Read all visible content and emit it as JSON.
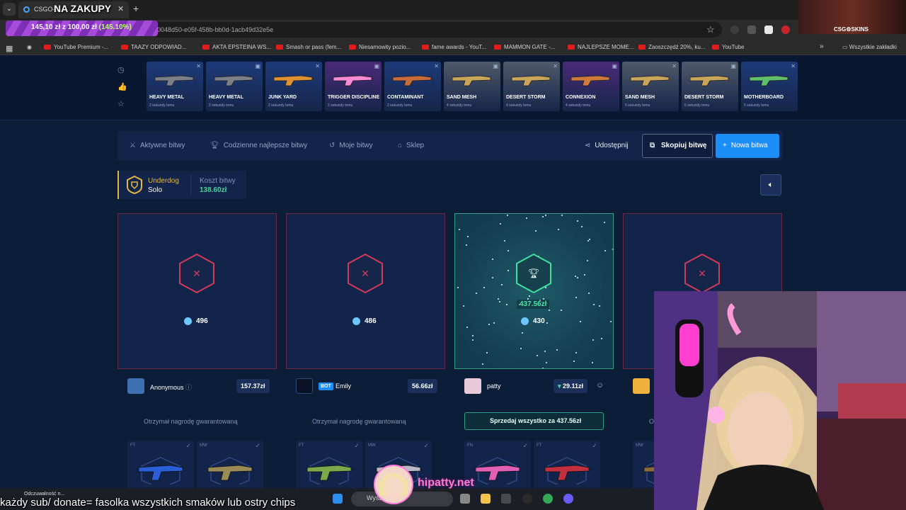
{
  "overlay": {
    "title": "NA ZAKUPY",
    "promo": {
      "current": "145,10 zł",
      "connector": "z",
      "target": "100,00 zł",
      "percent": "(145.10%)"
    },
    "chat_line": "każdy sub/ donate= fasolka wszystkich smaków lub ostry chips",
    "watermark": "hipatty.net",
    "cam_logo": "CSG⚙SKINS"
  },
  "browser": {
    "tab_title": "CSGO-S...",
    "url": "0048d50-e05f-458b-bb0d-1acb49d32e5e",
    "bookmarks": [
      "YouTube Premium -...",
      "TAAZY ODPOWIAD...",
      "AKTA EPSTEINA WS...",
      "Smash or pass (fem...",
      "Niesamowity pozio...",
      "fame awards - YouT...",
      "MAMMON GATE -...",
      "NAJLEPSZE MOME...",
      "Zaoszczędź 20%, ku...",
      "YouTube"
    ],
    "all_bookmarks": "Wszystkie zakładki"
  },
  "ticker": [
    {
      "name": "HEAVY METAL",
      "time": "2 sekundy temu",
      "color": "#1e3a7a"
    },
    {
      "name": "HEAVY METAL",
      "time": "2 sekundy temu",
      "color": "#1e3a7a"
    },
    {
      "name": "JUNK YARD",
      "time": "2 sekundy temu",
      "color": "#1e3a7a"
    },
    {
      "name": "TRIGGER DISCIPLINE",
      "time": "2 sekundy temu",
      "color": "#4a2a78"
    },
    {
      "name": "CONTAMINANT",
      "time": "2 sekundy temu",
      "color": "#1e3a7a"
    },
    {
      "name": "SAND MESH",
      "time": "4 sekundy temu",
      "color": "#4f5a6a"
    },
    {
      "name": "DESERT STORM",
      "time": "4 sekundy temu",
      "color": "#4f5a6a"
    },
    {
      "name": "CONNEXION",
      "time": "4 sekundy temu",
      "color": "#4a2a78"
    },
    {
      "name": "SAND MESH",
      "time": "5 sekundy temu",
      "color": "#4f5a6a"
    },
    {
      "name": "DESERT STORM",
      "time": "5 sekundy temu",
      "color": "#4f5a6a"
    },
    {
      "name": "MOTHERBOARD",
      "time": "5 sekundy temu",
      "color": "#1e3a7a"
    }
  ],
  "nav": {
    "active_battles": "Aktywne bitwy",
    "daily_best": "Codzienne najlepsze bitwy",
    "my_battles": "Moje bitwy",
    "shop": "Sklep",
    "share": "Udostępnij",
    "copy": "Skopiuj bitwę",
    "new": "Nowa bitwa"
  },
  "battle": {
    "mode": "Underdog",
    "type": "Solo",
    "cost_label": "Koszt bitwy",
    "cost": "138.60zł"
  },
  "players": [
    {
      "coins": "496",
      "name": "Anonymous",
      "value": "157.37zł",
      "status": "Otrzymał nagrodę gwarantowaną",
      "items": [
        "FT",
        "MW"
      ]
    },
    {
      "coins": "486",
      "name": "Emily",
      "bot": "BOT",
      "value": "56.66zł",
      "status": "Otrzymał nagrodę gwarantowaną",
      "items": [
        "FT",
        "MW"
      ]
    },
    {
      "coins": "430",
      "name": "patty",
      "value": "29.11zł",
      "winner_amount": "437.56zł",
      "sell": "Sprzedaj wszystko za 437.56zł",
      "items": [
        "FN",
        "FT"
      ]
    },
    {
      "name": "",
      "status": "O",
      "items": [
        "MW"
      ]
    }
  ],
  "taskbar": {
    "search": "Wyszu",
    "notif": "Odczuwalność n..."
  },
  "colors": {
    "accent": "#1c8ef7",
    "win": "#2aa380",
    "lose": "#d23a5a",
    "gold": "#e3b745"
  }
}
